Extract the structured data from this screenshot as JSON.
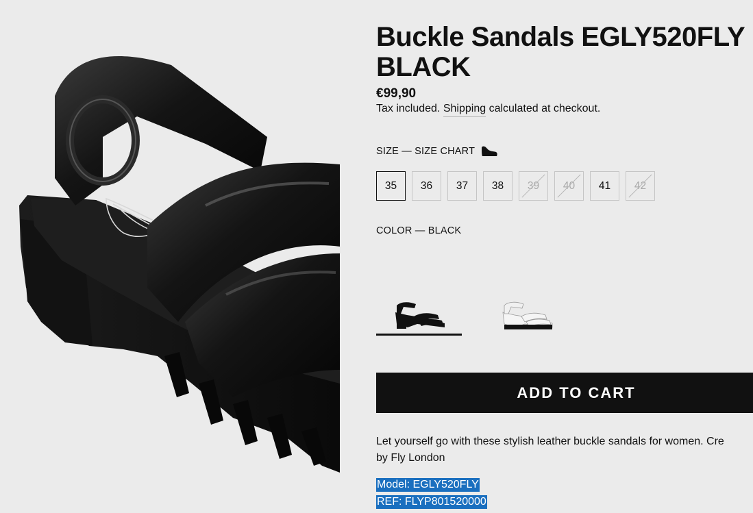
{
  "product": {
    "title": "Buckle Sandals EGLY520FLY BLACK",
    "price": "€99,90",
    "tax_prefix": "Tax included.",
    "shipping_link": "Shipping",
    "tax_suffix": "calculated at checkout."
  },
  "size": {
    "label": "SIZE — SIZE CHART",
    "chart_icon": "shoe-icon",
    "options": [
      {
        "label": "35",
        "selected": true,
        "available": true
      },
      {
        "label": "36",
        "selected": false,
        "available": true
      },
      {
        "label": "37",
        "selected": false,
        "available": true
      },
      {
        "label": "38",
        "selected": false,
        "available": true
      },
      {
        "label": "39",
        "selected": false,
        "available": false
      },
      {
        "label": "40",
        "selected": false,
        "available": false
      },
      {
        "label": "41",
        "selected": false,
        "available": true
      },
      {
        "label": "42",
        "selected": false,
        "available": false
      }
    ]
  },
  "color": {
    "label": "COLOR — BLACK",
    "swatches": [
      {
        "name": "black",
        "active": true
      },
      {
        "name": "white",
        "active": false
      }
    ]
  },
  "cart": {
    "label": "ADD TO CART"
  },
  "description": {
    "text_line1": "Let yourself go with these stylish leather buckle sandals for women. Cre",
    "text_line2": "by Fly London",
    "model": "Model: EGLY520FLY",
    "ref": "REF: FLYP801520000"
  },
  "colors": {
    "accent": "#111111",
    "selection": "#1a6fbf",
    "background": "#ebebeb"
  }
}
